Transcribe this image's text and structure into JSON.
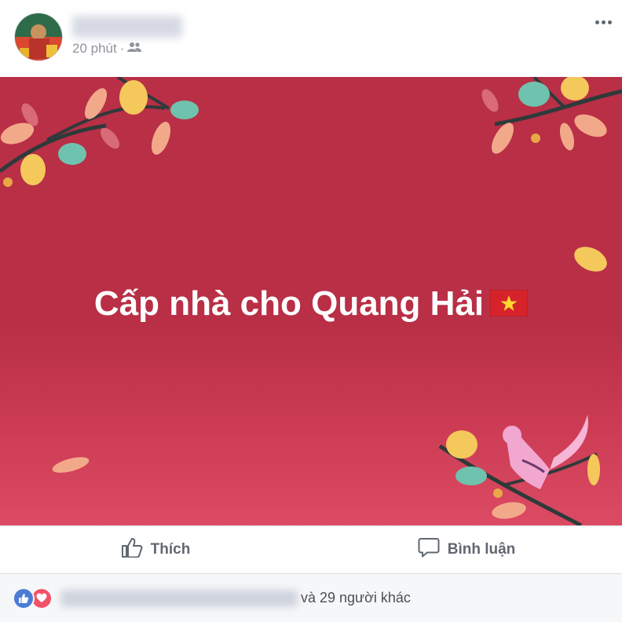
{
  "post": {
    "time": "20 phút",
    "separator": "·",
    "privacy_icon": "friends-icon",
    "more_icon": "more-dots-icon"
  },
  "banner": {
    "text": "Cấp nhà cho Quang Hải",
    "flag_icon": "vietnam-flag-icon",
    "background": "#b82f46"
  },
  "actions": {
    "like_label": "Thích",
    "comment_label": "Bình luận"
  },
  "reactions": {
    "others_text": "và 29 người khác",
    "like_color": "#4a7bd5",
    "love_color": "#f25268"
  }
}
